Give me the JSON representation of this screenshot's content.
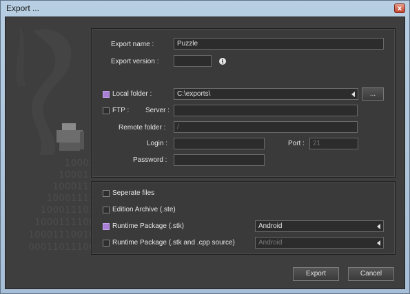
{
  "window": {
    "title": "Export ...",
    "close_glyph": "x"
  },
  "watermark": {
    "lines": [
      "10001",
      "100011",
      "1000111",
      "10001111",
      "100011101",
      "1000111100",
      "10001110010",
      "00011011100"
    ]
  },
  "export_panel": {
    "name_label": "Export name :",
    "name_value": "Puzzle",
    "version_label": "Export version :",
    "version_value": "",
    "local_folder_label": "Local folder :",
    "local_folder_checked": true,
    "local_folder_value": "C:\\exports\\",
    "browse_label": "...",
    "ftp_label": "FTP :",
    "ftp_checked": false,
    "server_label": "Server :",
    "server_value": "",
    "remote_folder_label": "Remote folder :",
    "remote_folder_value": "/",
    "login_label": "Login :",
    "login_value": "",
    "port_label": "Port :",
    "port_value": "21",
    "password_label": "Password :",
    "password_value": ""
  },
  "options_panel": {
    "separate_files_label": "Seperate files",
    "separate_files_checked": false,
    "edition_archive_label": "Edition Archive (.ste)",
    "edition_archive_checked": false,
    "runtime_package_label": "Runtime Package (.stk)",
    "runtime_package_checked": true,
    "runtime_package_platform": "Android",
    "runtime_source_label": "Runtime Package (.stk and .cpp source)",
    "runtime_source_checked": false,
    "runtime_source_platform": "Android"
  },
  "buttons": {
    "export": "Export",
    "cancel": "Cancel"
  },
  "colors": {
    "accent_checkbox": "#a980d6",
    "client_bg": "#3e3e3e"
  }
}
